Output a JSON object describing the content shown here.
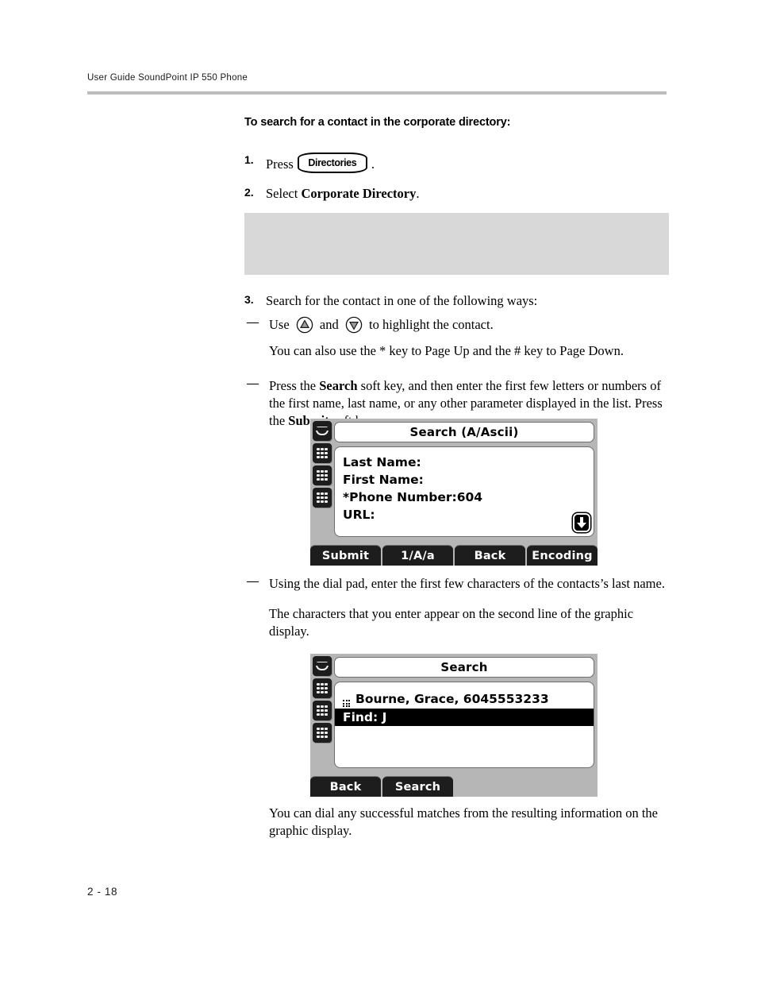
{
  "header": {
    "running_head": "User Guide SoundPoint IP 550 Phone"
  },
  "footer": {
    "page_number": "2 - 18"
  },
  "main": {
    "heading": "To search for a contact in the corporate directory:",
    "step1": {
      "number": "1.",
      "text_before": "Press",
      "hardkey_label": "Directories",
      "text_after": "."
    },
    "step2": {
      "number": "2.",
      "text_before": "Select ",
      "emphasis": "Corporate Directory",
      "text_after": "."
    },
    "step3": {
      "number": "3.",
      "text": "Search for the contact in one of the following ways:"
    },
    "bullet1": {
      "dash": "—",
      "text_before": "Use ",
      "icon_up": "up-arrow-key-icon",
      "text_middle": " and ",
      "icon_down": "down-arrow-key-icon",
      "text_after": " to highlight the contact.",
      "note": "You can also use the * key to Page Up and the # key to Page Down."
    },
    "bullet2": {
      "dash": "—",
      "part1": "Press the ",
      "bold1": "Search",
      "part2": " soft key, and then enter the first few letters or numbers of the first name, last name, or any other parameter displayed in the list. Press the ",
      "bold2": "Submit",
      "part3": " soft key."
    },
    "bullet3": {
      "dash": "—",
      "text": "Using the dial pad, enter the first few characters of the contacts’s last name.",
      "note": "The characters that you enter appear on the second line of the graphic display."
    },
    "closing": "You can dial any successful matches from the resulting information on the graphic display."
  },
  "lcd1": {
    "title": "Search (A/Ascii)",
    "lines": [
      "Last Name:",
      "First Name:",
      "*Phone Number:604",
      "URL:"
    ],
    "scroll_indicator": "scroll-down-icon",
    "softkeys": [
      "Submit",
      "1/A/a",
      "Back",
      "Encoding"
    ],
    "rail_icons": [
      "handset-icon",
      "keypad-icon",
      "keypad-icon",
      "keypad-icon"
    ]
  },
  "lcd2": {
    "title": "Search",
    "contact_row": "Bourne, Grace, 6045553233",
    "find_row": "Find: J",
    "softkeys": [
      "Back",
      "Search"
    ],
    "rail_icons": [
      "handset-icon",
      "keypad-icon",
      "keypad-icon",
      "keypad-icon"
    ]
  },
  "colors": {
    "rule": "#bdbdbd",
    "placeholder": "#d8d8d8",
    "lcd_bezel": "#b6b6b6",
    "softkey": "#1d1d1d"
  }
}
